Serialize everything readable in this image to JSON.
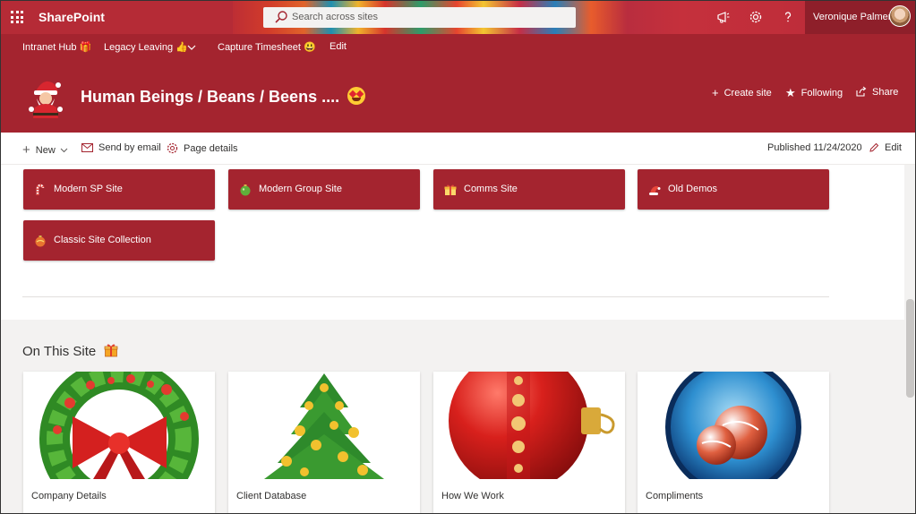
{
  "suite": {
    "brand": "SharePoint",
    "search_placeholder": "Search across sites",
    "user_name": "Veronique Palmer"
  },
  "hubnav": {
    "items": [
      {
        "label": "Intranet Hub 🎁"
      },
      {
        "label": "Legacy Leaving 👍"
      },
      {
        "label": "Capture Timesheet 😃"
      },
      {
        "label": "Edit"
      }
    ]
  },
  "site": {
    "title": "Human Beings / Beans / Beens ....",
    "actions": {
      "create": "Create site",
      "following": "Following",
      "share": "Share"
    }
  },
  "commandbar": {
    "new": "New",
    "send": "Send by email",
    "details": "Page details",
    "published": "Published 11/24/2020",
    "edit": "Edit"
  },
  "quicklinks": [
    {
      "label": "Modern SP Site"
    },
    {
      "label": "Modern Group Site"
    },
    {
      "label": "Comms Site"
    },
    {
      "label": "Old Demos"
    },
    {
      "label": "Classic Site Collection"
    }
  ],
  "section": {
    "title": "On This Site"
  },
  "cards": [
    {
      "label": "Company Details"
    },
    {
      "label": "Client Database"
    },
    {
      "label": "How We Work"
    },
    {
      "label": "Compliments"
    }
  ],
  "colors": {
    "theme": "#a4242f",
    "suitebar": "#b52b36"
  }
}
